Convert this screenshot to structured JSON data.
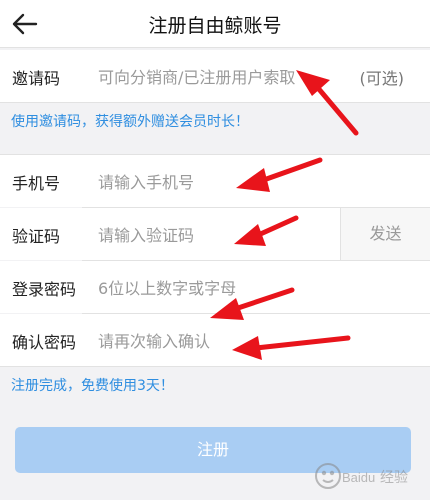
{
  "header": {
    "title": "注册自由鲸账号",
    "back_icon": "back-arrow-icon"
  },
  "invite": {
    "label": "邀请码",
    "placeholder": "可向分销商/已注册用户索取",
    "optional": "(可选)"
  },
  "invite_hint": "使用邀请码，获得额外赠送会员时长！",
  "phone": {
    "label": "手机号",
    "placeholder": "请输入手机号"
  },
  "code": {
    "label": "验证码",
    "placeholder": "请输入验证码",
    "send_label": "发送"
  },
  "password": {
    "label": "登录密码",
    "placeholder": "6位以上数字或字母"
  },
  "confirm": {
    "label": "确认密码",
    "placeholder": "请再次输入确认"
  },
  "footer_hint": "注册完成，免费使用3天！",
  "register_button": "注册",
  "watermark": {
    "logo_text": "Baidu",
    "text": "经验"
  },
  "colors": {
    "hint": "#2f8ee0",
    "button": "#a9cdf3",
    "arrows": "#e8141b"
  }
}
